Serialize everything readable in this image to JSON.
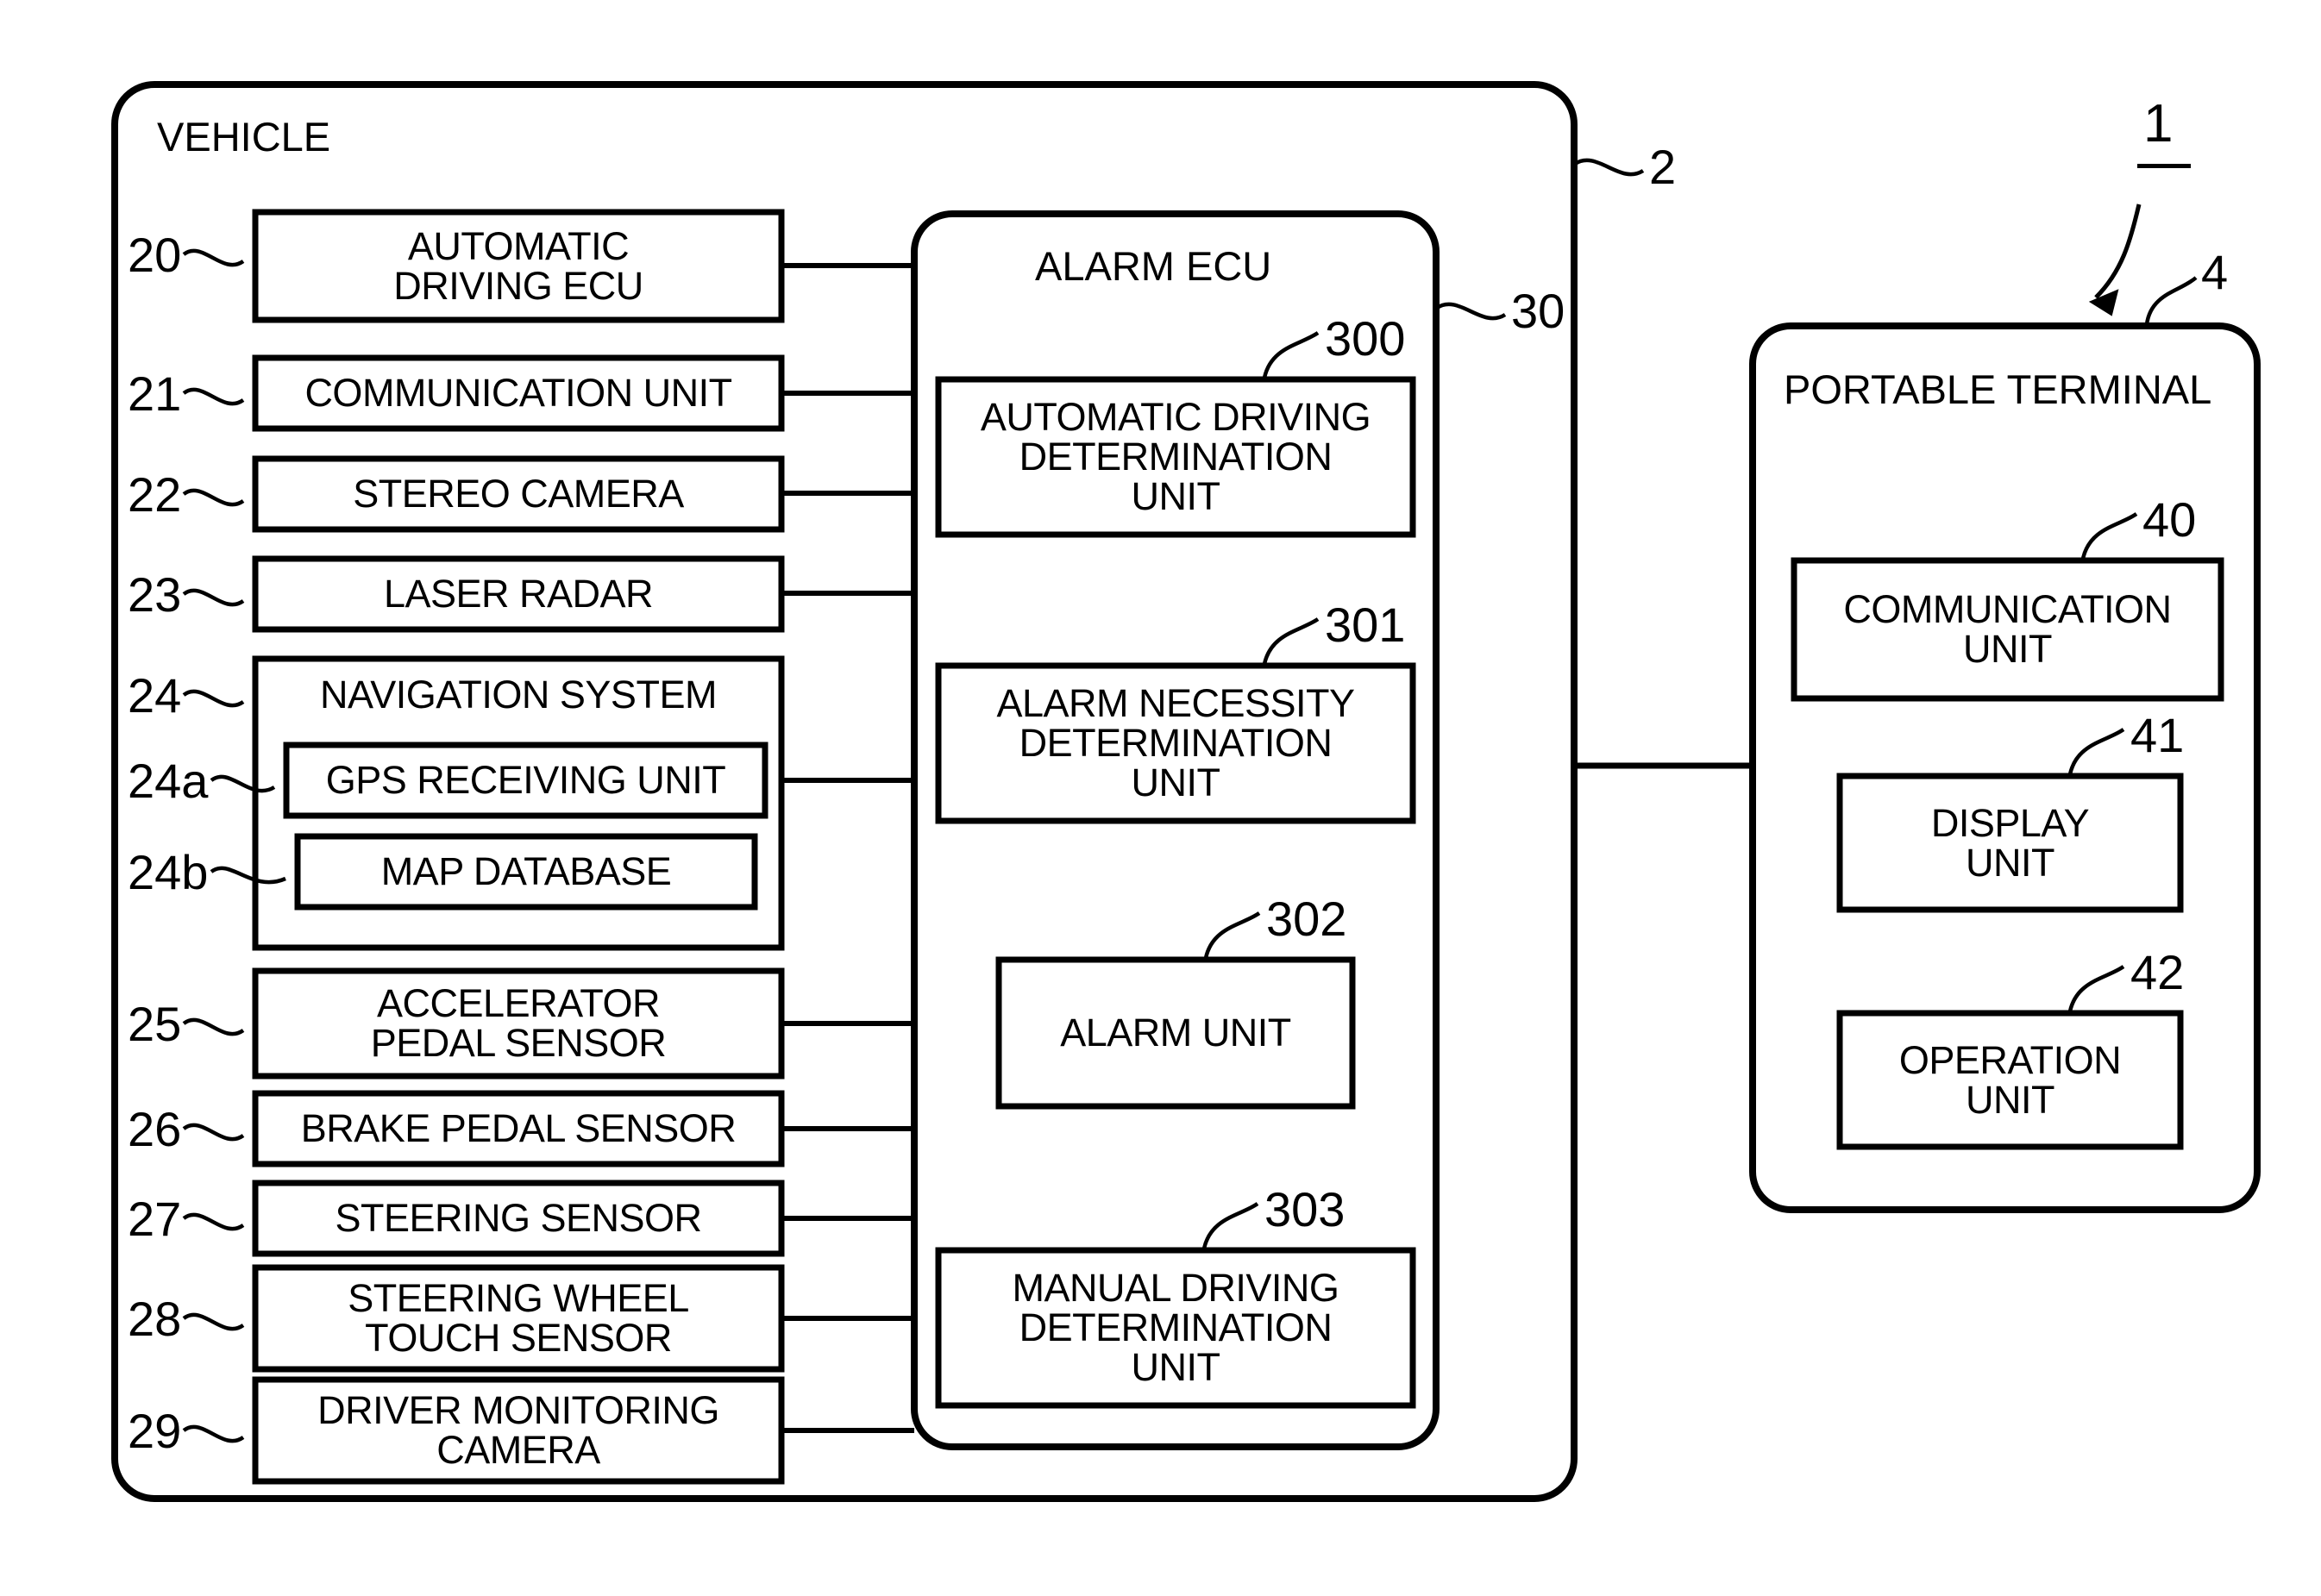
{
  "figure": {
    "type": "patent-block-diagram",
    "system_reference": "1",
    "background": "#ffffff",
    "line_color": "#000000"
  },
  "vehicle": {
    "title": "VEHICLE",
    "reference": "2",
    "components": [
      {
        "reference": "20",
        "label": "AUTOMATIC\nDRIVING ECU"
      },
      {
        "reference": "21",
        "label": "COMMUNICATION UNIT"
      },
      {
        "reference": "22",
        "label": "STEREO CAMERA"
      },
      {
        "reference": "23",
        "label": "LASER RADAR"
      },
      {
        "reference": "24",
        "label": "NAVIGATION SYSTEM"
      },
      {
        "reference": "24a",
        "label": "GPS RECEIVING UNIT"
      },
      {
        "reference": "24b",
        "label": "MAP DATABASE"
      },
      {
        "reference": "25",
        "label": "ACCELERATOR\nPEDAL SENSOR"
      },
      {
        "reference": "26",
        "label": "BRAKE PEDAL SENSOR"
      },
      {
        "reference": "27",
        "label": "STEERING SENSOR"
      },
      {
        "reference": "28",
        "label": "STEERING WHEEL\nTOUCH SENSOR"
      },
      {
        "reference": "29",
        "label": "DRIVER MONITORING\nCAMERA"
      }
    ]
  },
  "alarm_ecu": {
    "title": "ALARM ECU",
    "reference": "30",
    "units": [
      {
        "reference": "300",
        "label": "AUTOMATIC DRIVING\nDETERMINATION\nUNIT"
      },
      {
        "reference": "301",
        "label": "ALARM NECESSITY\nDETERMINATION\nUNIT"
      },
      {
        "reference": "302",
        "label": "ALARM UNIT"
      },
      {
        "reference": "303",
        "label": "MANUAL DRIVING\nDETERMINATION\nUNIT"
      }
    ]
  },
  "portable_terminal": {
    "title": "PORTABLE TERMINAL",
    "reference": "4",
    "units": [
      {
        "reference": "40",
        "label": "COMMUNICATION\nUNIT"
      },
      {
        "reference": "41",
        "label": "DISPLAY\nUNIT"
      },
      {
        "reference": "42",
        "label": "OPERATION\nUNIT"
      }
    ]
  }
}
